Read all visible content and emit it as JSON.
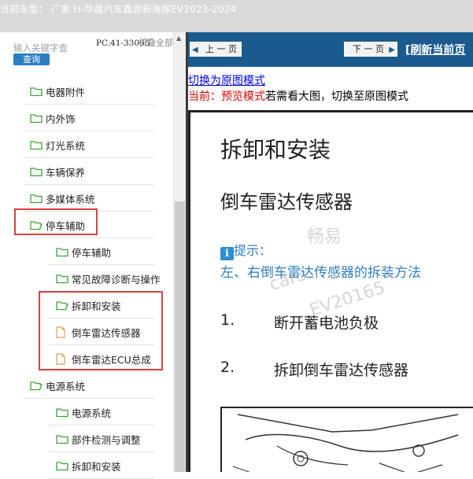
{
  "titlebar": {
    "text": "当前车型：  厂家:H-华晨汽车鑫源新海豚EV2023-2024"
  },
  "search": {
    "placeholder": "输入关键字查",
    "query_label": "查询",
    "code": "PC.41-33065",
    "fold_label": "折叠全部"
  },
  "tree": [
    {
      "label": "电器附件",
      "type": "folder",
      "level": 1
    },
    {
      "label": "内外饰",
      "type": "folder",
      "level": 1
    },
    {
      "label": "灯光系统",
      "type": "folder",
      "level": 1
    },
    {
      "label": "车辆保养",
      "type": "folder",
      "level": 1
    },
    {
      "label": "多媒体系统",
      "type": "folder",
      "level": 1
    },
    {
      "label": "停车辅助",
      "type": "folder-open",
      "level": 1
    },
    {
      "label": "停车辅助",
      "type": "folder",
      "level": 2
    },
    {
      "label": "常见故障诊断与操作",
      "type": "folder",
      "level": 2
    },
    {
      "label": "拆卸和安装",
      "type": "folder-open",
      "level": 2
    },
    {
      "label": "倒车雷达传感器",
      "type": "doc",
      "level": 2
    },
    {
      "label": "倒车雷达ECU总成",
      "type": "doc",
      "level": 2
    },
    {
      "label": "电源系统",
      "type": "folder-open",
      "level": 1
    },
    {
      "label": "电源系统",
      "type": "folder",
      "level": 2
    },
    {
      "label": "部件检测与调整",
      "type": "folder",
      "level": 2
    },
    {
      "label": "拆卸和安装",
      "type": "folder",
      "level": 2
    }
  ],
  "nav": {
    "prev_label": "上 一 页",
    "next_label": "下 一 页",
    "refresh_label": "[刷新当前页"
  },
  "mode": {
    "switch_link": "切换为原图模式",
    "current_prefix": "当前：预览模式",
    "current_suffix": "若需看大图，切换至原图模式"
  },
  "doc": {
    "title": "拆卸和安装",
    "subtitle": "倒车雷达传感器",
    "tip_label": "提示：",
    "tip_text": "左、右倒车雷达传感器的拆装方法",
    "steps": [
      {
        "num": "1.",
        "text": "断开蓄电池负极"
      },
      {
        "num": "2.",
        "text": "拆卸倒车雷达传感器"
      }
    ]
  },
  "watermark": {
    "line1": "畅易",
    "line2": "car3",
    "line3": "EV20165"
  },
  "colors": {
    "folder": "#3aa335",
    "doc": "#e0a050",
    "highlight": "#e0403e",
    "nav_bar": "#1a5a8f"
  }
}
